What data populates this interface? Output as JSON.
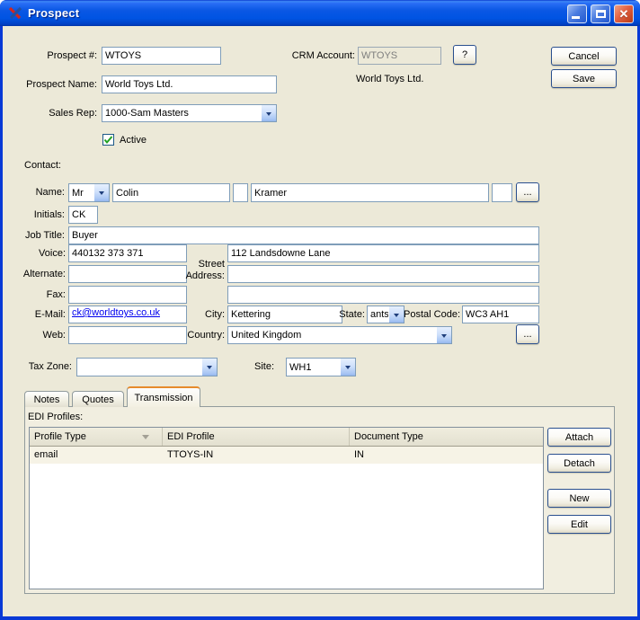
{
  "window": {
    "title": "Prospect"
  },
  "icons": {
    "close": "✕"
  },
  "colors": {
    "titlebar_blue": "#0054e3",
    "window_border": "#0839d6",
    "client_bg": "#ece9d8",
    "input_border": "#7f9db9",
    "active_tab_accent": "#e68b2c",
    "link_blue": "#0000ee",
    "checkmark_green": "#21a121"
  },
  "header": {
    "prospect_number": {
      "label": "Prospect #:",
      "value": "WTOYS"
    },
    "crm_account": {
      "label": "CRM Account:",
      "value": "WTOYS",
      "help": "?",
      "display_name": "World Toys Ltd."
    },
    "cancel": "Cancel",
    "save": "Save",
    "prospect_name": {
      "label": "Prospect Name:",
      "value": "World Toys Ltd."
    },
    "sales_rep": {
      "label": "Sales Rep:",
      "value": "1000-Sam Masters"
    },
    "active": {
      "label": "Active",
      "checked": true
    }
  },
  "contact": {
    "section_label": "Contact:",
    "name": {
      "label": "Name:",
      "honorific": "Mr",
      "first": "Colin",
      "middle": "",
      "last": "Kramer",
      "suffix": "",
      "more": "..."
    },
    "initials": {
      "label": "Initials:",
      "value": "CK"
    },
    "job_title": {
      "label": "Job Title:",
      "value": "Buyer"
    },
    "voice": {
      "label": "Voice:",
      "value": "440132 373 371"
    },
    "alternate": {
      "label": "Alternate:",
      "value": ""
    },
    "fax": {
      "label": "Fax:",
      "value": ""
    },
    "email": {
      "label": "E-Mail:",
      "value": "ck@worldtoys.co.uk"
    },
    "web": {
      "label": "Web:",
      "value": ""
    },
    "street_address": {
      "label": "Street Address:",
      "line1": "112 Landsdowne Lane",
      "line2": "",
      "line3": ""
    },
    "city": {
      "label": "City:",
      "value": "Kettering"
    },
    "state": {
      "label": "State:",
      "value": "ants"
    },
    "postal_code": {
      "label": "Postal Code:",
      "value": "WC3 AH1"
    },
    "country": {
      "label": "Country:",
      "value": "United Kingdom",
      "more": "..."
    }
  },
  "footer": {
    "tax_zone": {
      "label": "Tax Zone:",
      "value": ""
    },
    "site": {
      "label": "Site:",
      "value": "WH1"
    }
  },
  "tabs": [
    {
      "label": "Notes",
      "active": false
    },
    {
      "label": "Quotes",
      "active": false
    },
    {
      "label": "Transmission",
      "active": true
    }
  ],
  "transmission": {
    "edi_profiles_label": "EDI Profiles:",
    "table": {
      "columns": [
        "Profile Type",
        "EDI Profile",
        "Document Type"
      ],
      "rows": [
        [
          "email",
          "TTOYS-IN",
          "IN"
        ]
      ],
      "sorted_column": "Profile Type"
    },
    "buttons": {
      "attach": "Attach",
      "detach": "Detach",
      "new": "New",
      "edit": "Edit"
    }
  }
}
